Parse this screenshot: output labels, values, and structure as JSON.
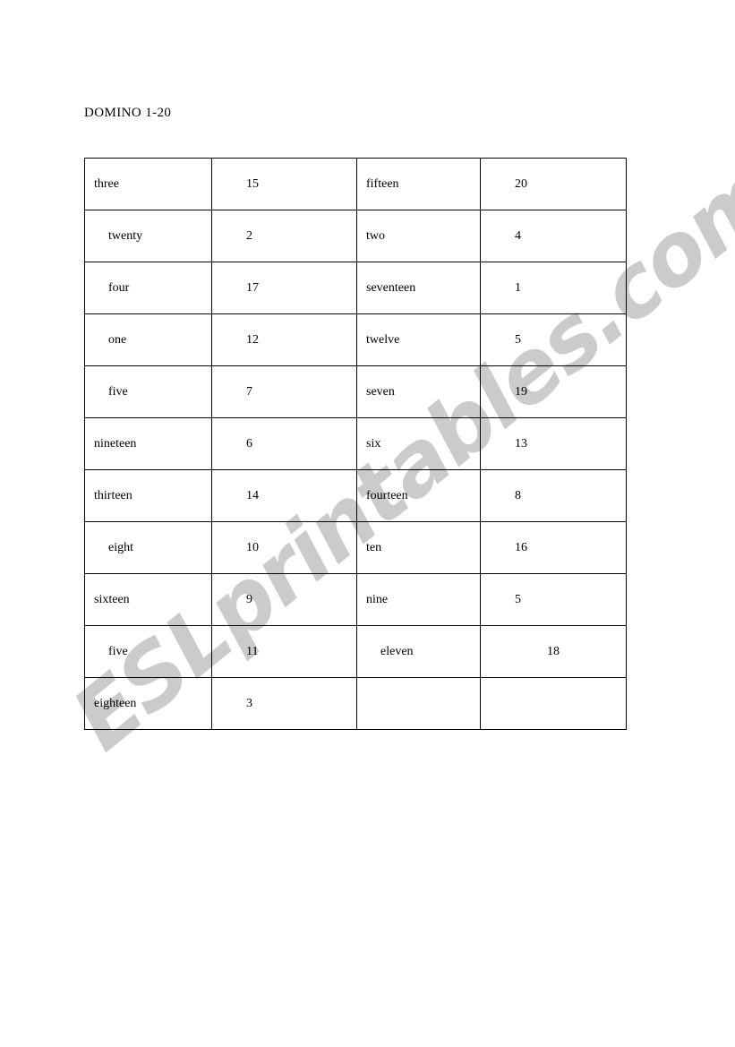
{
  "document": {
    "title": "DOMINO 1-20",
    "watermark": "ESLprintables.com",
    "watermark_color": "#cbcbcb",
    "page_background": "#ffffff",
    "text_color": "#000000",
    "border_color": "#000000"
  },
  "table": {
    "columns": 4,
    "rows": [
      {
        "c1": "three",
        "c2": "15",
        "c3": "fifteen",
        "c4": "20"
      },
      {
        "c1": "twenty",
        "c2": "2",
        "c3": "two",
        "c4": "4"
      },
      {
        "c1": "four",
        "c2": "17",
        "c3": "seventeen",
        "c4": "1"
      },
      {
        "c1": "one",
        "c2": "12",
        "c3": "twelve",
        "c4": "5"
      },
      {
        "c1": "five",
        "c2": "7",
        "c3": "seven",
        "c4": "19"
      },
      {
        "c1": "nineteen",
        "c2": "6",
        "c3": "six",
        "c4": "13"
      },
      {
        "c1": "thirteen",
        "c2": "14",
        "c3": "fourteen",
        "c4": "8"
      },
      {
        "c1": "eight",
        "c2": "10",
        "c3": "ten",
        "c4": "16"
      },
      {
        "c1": "sixteen",
        "c2": "9",
        "c3": "nine",
        "c4": "5"
      },
      {
        "c1": "five",
        "c2": "11",
        "c3": "eleven",
        "c4": "18"
      },
      {
        "c1": "eighteen",
        "c2": "3",
        "c3": "",
        "c4": ""
      }
    ]
  }
}
